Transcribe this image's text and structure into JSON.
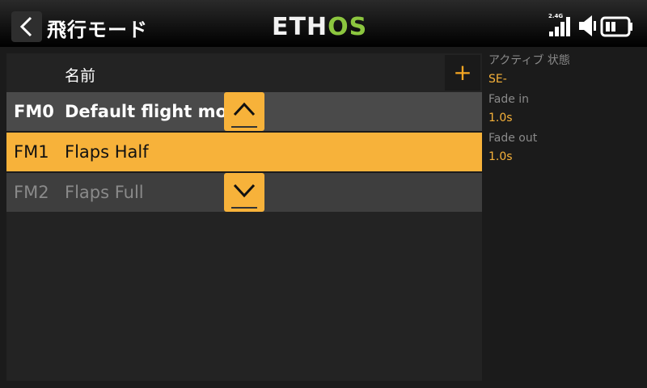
{
  "header": {
    "title": "飛行モード",
    "logo_left": "ETH",
    "logo_right": "OS",
    "rf_label": "2.4G"
  },
  "list": {
    "column_name": "名前",
    "add_label": "+",
    "rows": [
      {
        "code": "FM0",
        "label": "Default flight mode"
      },
      {
        "code": "FM1",
        "label": "Flaps Half"
      },
      {
        "code": "FM2",
        "label": "Flaps Full"
      }
    ]
  },
  "info": {
    "active_label": "アクティブ 状態",
    "active_value": "SE-",
    "fade_in_label": "Fade in",
    "fade_in_value": "1.0s",
    "fade_out_label": "Fade out",
    "fade_out_value": "1.0s"
  },
  "colors": {
    "accent": "#f7b23a",
    "logo_green": "#8cc63f"
  }
}
